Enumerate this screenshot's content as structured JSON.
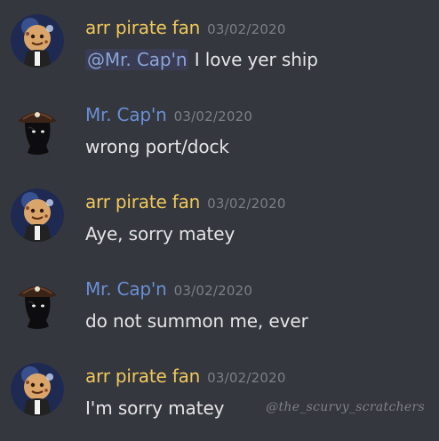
{
  "colors": {
    "background": "#35373e",
    "pirate_fan_name": "#f0c95c",
    "captain_name": "#6a8fd4",
    "timestamp": "#7c7f86",
    "message_text": "#e3e4e6",
    "mention": "#8aa5d9"
  },
  "users": {
    "fan": {
      "name": "arr pirate fan",
      "avatar_icon": "cookie-character-avatar"
    },
    "captain": {
      "name": "Mr. Cap'n",
      "avatar_icon": "shadow-pirate-captain-avatar"
    }
  },
  "messages": [
    {
      "author": "arr pirate fan",
      "timestamp": "03/02/2020",
      "mention": "@Mr. Cap'n",
      "text": " I love yer ship"
    },
    {
      "author": "Mr. Cap'n",
      "timestamp": "03/02/2020",
      "text": "wrong port/dock"
    },
    {
      "author": "arr pirate fan",
      "timestamp": "03/02/2020",
      "text": "Aye, sorry matey"
    },
    {
      "author": "Mr. Cap'n",
      "timestamp": "03/02/2020",
      "text": "do not summon me, ever"
    },
    {
      "author": "arr pirate fan",
      "timestamp": "03/02/2020",
      "text": "I'm sorry matey"
    }
  ],
  "watermark": "@the_scurvy_scratchers"
}
